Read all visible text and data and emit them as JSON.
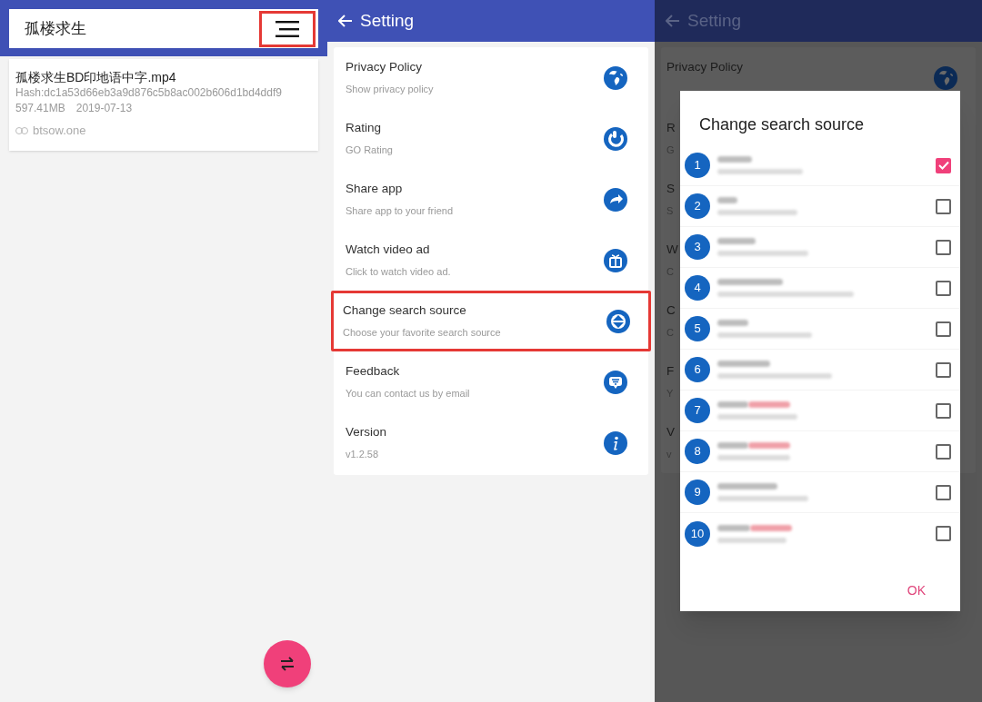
{
  "search_panel": {
    "search_field": {
      "value": "孤楼求生"
    },
    "menu_button": {
      "highlighted": true
    },
    "results": [
      {
        "title": "孤楼求生BD印地语中字.mp4",
        "hash": "Hash:dc1a53d66eb3a9d876c5b8ac002b606d1bd4ddf9",
        "size": "597.41MB",
        "date": "2019-07-13",
        "source": "btsow.one"
      }
    ]
  },
  "settings_panel": {
    "title": "Setting",
    "items": [
      {
        "title": "Privacy Policy",
        "subtitle": "Show privacy policy",
        "highlighted": false
      },
      {
        "title": "Rating",
        "subtitle": "GO Rating",
        "highlighted": false
      },
      {
        "title": "Share app",
        "subtitle": "Share app to your friend",
        "highlighted": false
      },
      {
        "title": "Watch video ad",
        "subtitle": "Click to watch video ad.",
        "highlighted": false
      },
      {
        "title": "Change search source",
        "subtitle": "Choose your favorite search source",
        "highlighted": true
      },
      {
        "title": "Feedback",
        "subtitle": "You can contact us by email",
        "highlighted": false
      },
      {
        "title": "Version",
        "subtitle": "v1.2.58",
        "highlighted": false
      }
    ]
  },
  "dialog_panel": {
    "title": "Setting",
    "behind_items": [
      {
        "title": "Privacy Policy"
      },
      {
        "title": "R",
        "subtitle": "G"
      },
      {
        "title": "S",
        "subtitle": "S"
      },
      {
        "title": "W",
        "subtitle": "C"
      },
      {
        "title": "C",
        "subtitle": "C"
      },
      {
        "title": "F",
        "subtitle": "Y"
      },
      {
        "title": "V",
        "subtitle": "v"
      }
    ],
    "dialog": {
      "title": "Change search source",
      "ok": "OK",
      "sources": [
        {
          "number": "1",
          "checked": true,
          "invalid": false
        },
        {
          "number": "2",
          "checked": false,
          "invalid": false
        },
        {
          "number": "3",
          "checked": false,
          "invalid": false
        },
        {
          "number": "4",
          "checked": false,
          "invalid": false
        },
        {
          "number": "5",
          "checked": false,
          "invalid": false
        },
        {
          "number": "6",
          "checked": false,
          "invalid": false
        },
        {
          "number": "7",
          "checked": false,
          "invalid": true
        },
        {
          "number": "8",
          "checked": false,
          "invalid": true
        },
        {
          "number": "9",
          "checked": false,
          "invalid": false
        },
        {
          "number": "10",
          "checked": false,
          "invalid": true
        }
      ]
    }
  }
}
